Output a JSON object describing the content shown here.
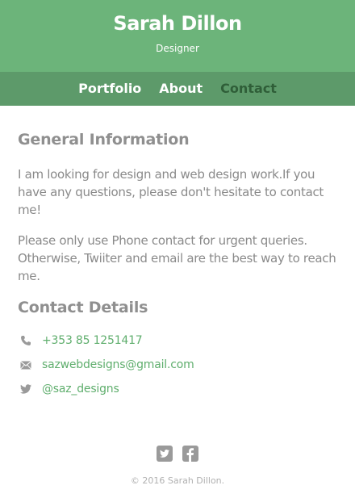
{
  "header": {
    "title": "Sarah Dillon",
    "subtitle": "Designer"
  },
  "nav": {
    "items": [
      {
        "label": "Portfolio",
        "active": false
      },
      {
        "label": "About",
        "active": false
      },
      {
        "label": "Contact",
        "active": true
      }
    ]
  },
  "main": {
    "general_heading": "General Information",
    "paragraphs": [
      "I am looking for design and web design work.If you have any questions, please don't hesitate to contact me!",
      "Please only use Phone contact for urgent queries. Otherwise, Twiiter and email are the best way to reach me."
    ],
    "contact_heading": "Contact Details",
    "contacts": [
      {
        "icon": "phone-icon",
        "value": "+353 85 1251417"
      },
      {
        "icon": "envelope-icon",
        "value": "sazwebdesigns@gmail.com"
      },
      {
        "icon": "twitter-icon",
        "value": "@saz_designs"
      }
    ]
  },
  "footer": {
    "social": [
      {
        "icon": "twitter-icon"
      },
      {
        "icon": "facebook-icon"
      }
    ],
    "copyright": "© 2016 Sarah Dillon."
  },
  "colors": {
    "header_bg": "#6cb47a",
    "nav_bg": "#5d9a6a",
    "nav_active": "#2f5e38",
    "link": "#5fae6d",
    "text": "#8a8a8a"
  }
}
